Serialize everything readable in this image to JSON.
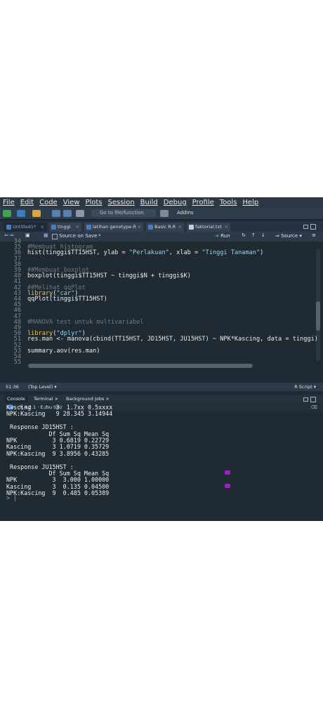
{
  "menu": [
    "File",
    "Edit",
    "Code",
    "View",
    "Plots",
    "Session",
    "Build",
    "Debug",
    "Profile",
    "Tools",
    "Help"
  ],
  "toolbar": {
    "goto_placeholder": "Go to file/function",
    "addins_label": "Addins"
  },
  "tabs": [
    {
      "label": "Untitled1*",
      "active": true
    },
    {
      "label": "tinggi",
      "active": false
    },
    {
      "label": "latihan genotype.R",
      "active": false
    },
    {
      "label": "Basic R.R",
      "active": false
    },
    {
      "label": "faktorial.txt",
      "active": false
    }
  ],
  "editor_toolbar": {
    "source_on_save": "Source on Save",
    "run": "Run",
    "source": "Source"
  },
  "code_lines": [
    {
      "n": "34",
      "t": ""
    },
    {
      "n": "35",
      "t": "#Membuat histogram",
      "c": "cmt"
    },
    {
      "n": "36",
      "t": "hist(tinggi$TT15HST, ylab = \"Perlakuan\", xlab = \"Tinggi Tanaman\")"
    },
    {
      "n": "37",
      "t": ""
    },
    {
      "n": "38",
      "t": ""
    },
    {
      "n": "39",
      "t": "##Membuat boxplot",
      "c": "cmt"
    },
    {
      "n": "40",
      "t": "boxplot(tinggi$TT15HST ~ tinggi$N + tinggi$K)"
    },
    {
      "n": "41",
      "t": ""
    },
    {
      "n": "42",
      "t": "##Melihat qqPlot",
      "c": "cmt"
    },
    {
      "n": "43",
      "t": "library(\"car\")"
    },
    {
      "n": "44",
      "t": "qqPlot(tinggi$TT15HST)"
    },
    {
      "n": "45",
      "t": ""
    },
    {
      "n": "46",
      "t": ""
    },
    {
      "n": "47",
      "t": ""
    },
    {
      "n": "48",
      "t": "#MANOVA test untuk multivariabel",
      "c": "cmt"
    },
    {
      "n": "49",
      "t": ""
    },
    {
      "n": "50",
      "t": "library(\"dplyr\")"
    },
    {
      "n": "51",
      "t": "res.man <- manova(cbind(TT15HST, JD15HST, JU15HST) ~ NPK*Kascing, data = tinggi)"
    },
    {
      "n": "52",
      "t": ""
    },
    {
      "n": "53",
      "t": "summary.aov(res.man)"
    },
    {
      "n": "54",
      "t": ""
    },
    {
      "n": "55",
      "t": ""
    }
  ],
  "status": {
    "position": "51:36",
    "scope": "(Top Level)",
    "filetype": "R Script"
  },
  "panel_tabs": [
    "Console",
    "Terminal",
    "Background Jobs"
  ],
  "console_path": "R 4.2.1 · E:/bu tini/",
  "console_lines": [
    "Kascing       3  1.7xx 0.5xxxx",
    "NPK:Kascing   9 28.345 3.14944",
    "",
    " Response JD15HST :",
    "            Df Sum Sq Mean Sq",
    "NPK          3 0.6819 0.22729",
    "Kascing      3 1.0719 0.35729",
    "NPK:Kascing  9 3.8956 0.43285",
    "",
    " Response JU15HST :",
    "            Df Sum Sq Mean Sq",
    "NPK          3  3.000 1.00000",
    "Kascing      3  0.135 0.04500",
    "NPK:Kascing  9  0.485 0.05389",
    "",
    ""
  ],
  "console_prompt": "> |"
}
